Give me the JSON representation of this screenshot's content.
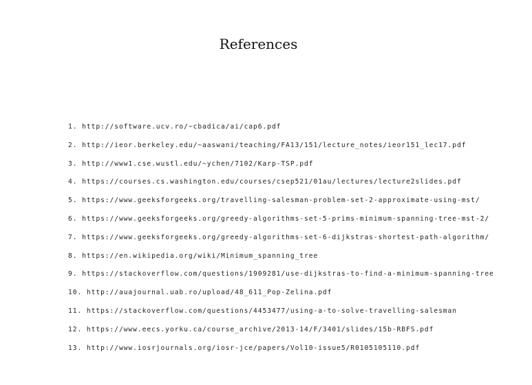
{
  "title": "References",
  "references": [
    "1. http://software.ucv.ro/~cbadica/ai/cap6.pdf",
    "2. http://ieor.berkeley.edu/~aaswani/teaching/FA13/151/lecture_notes/ieor151_lec17.pdf",
    "3. http://www1.cse.wustl.edu/~ychen/7102/Karp-TSP.pdf",
    "4. https://courses.cs.washington.edu/courses/csep521/01au/lectures/lecture2slides.pdf",
    "5. https://www.geeksforgeeks.org/travelling-salesman-problem-set-2-approximate-using-mst/",
    "6. https://www.geeksforgeeks.org/greedy-algorithms-set-5-prims-minimum-spanning-tree-mst-2/",
    "7. https://www.geeksforgeeks.org/greedy-algorithms-set-6-dijkstras-shortest-path-algorithm/",
    "8. https://en.wikipedia.org/wiki/Minimum_spanning_tree",
    "9. https://stackoverflow.com/questions/1909281/use-dijkstras-to-find-a-minimum-spanning-tree",
    "10. http://auajournal.uab.ro/upload/48_611_Pop-Zelina.pdf",
    "11. https://stackoverflow.com/questions/4453477/using-a-to-solve-travelling-salesman",
    "12. https://www.eecs.yorku.ca/course_archive/2013-14/F/3401/slides/15b-RBFS.pdf",
    "13. http://www.iosrjournals.org/iosr-jce/papers/Vol10-issue5/R0105105110.pdf"
  ]
}
